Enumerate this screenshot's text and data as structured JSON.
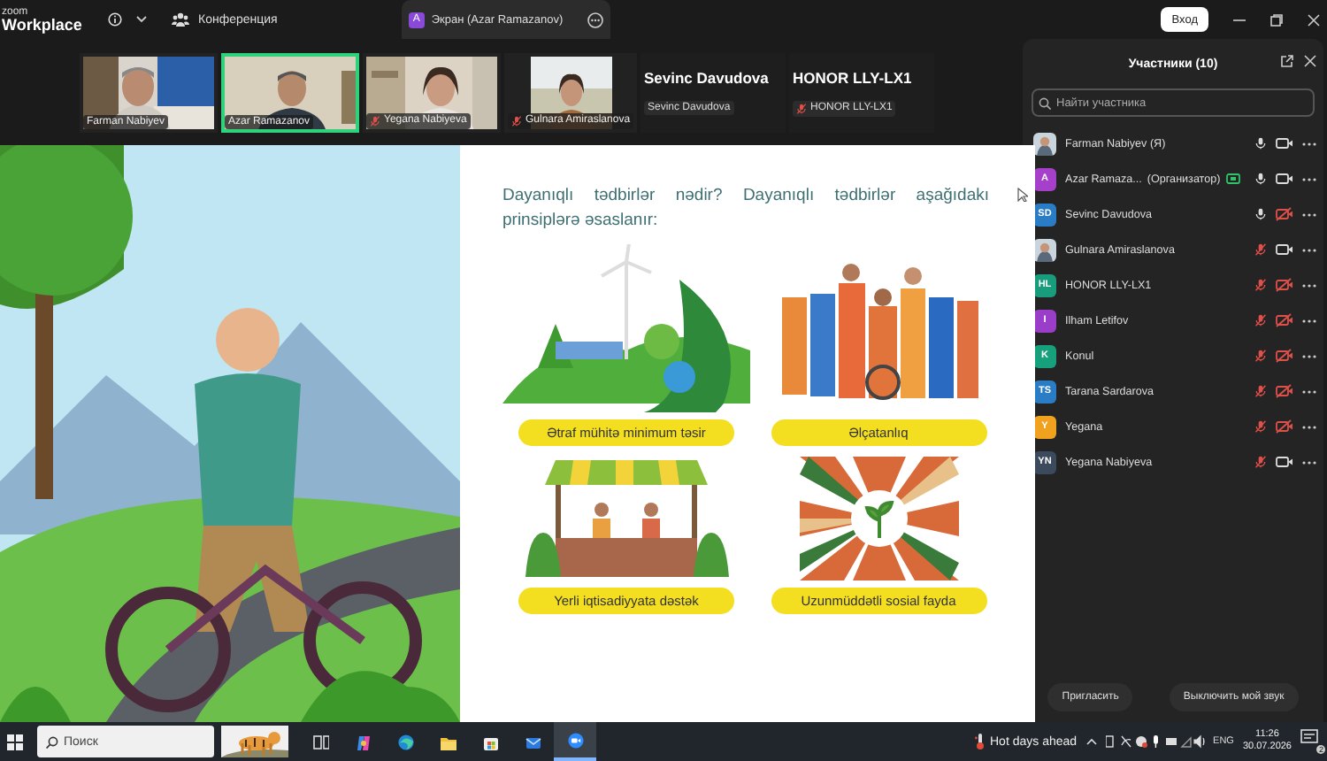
{
  "app": {
    "logo_top": "zoom",
    "logo_bottom": "Workplace"
  },
  "toolbar": {
    "meeting_label": "Конференция",
    "share_tab": {
      "initial": "A",
      "title": "Экран (Azar Ramazanov)"
    },
    "login_button": "Вход"
  },
  "videos": [
    {
      "kind": "video",
      "name": "Farman Nabiyev",
      "muted": false,
      "speaking": false
    },
    {
      "kind": "video",
      "name": "Azar Ramazanov",
      "muted": false,
      "speaking": true
    },
    {
      "kind": "video",
      "name": "Yegana Nabiyeva",
      "muted": true,
      "speaking": false
    },
    {
      "kind": "video",
      "name": "Gulnara Amiraslanova",
      "muted": true,
      "speaking": false
    },
    {
      "kind": "name",
      "title": "Sevinc Davudova",
      "name": "Sevinc Davudova",
      "muted": false,
      "speaking": false
    },
    {
      "kind": "name",
      "title": "HONOR LLY-LX1",
      "name": "HONOR LLY-LX1",
      "muted": true,
      "speaking": false
    }
  ],
  "slide": {
    "intro": "Dayanıqlı tədbirlər nədir? Dayanıqlı tədbirlər aşağıdakı prinsiplərə əsaslanır:",
    "cards": [
      {
        "label": "Ətraf mühitə minimum təsir"
      },
      {
        "label": "Əlçatanlıq"
      },
      {
        "label": "Yerli iqtisadiyyata dəstək"
      },
      {
        "label": "Uzunmüddətli sosial fayda"
      }
    ]
  },
  "participants": {
    "title": "Участники (10)",
    "search_placeholder": "Найти участника",
    "people": [
      {
        "name": "Farman Nabiyev (Я)",
        "muted": false,
        "video_off": false
      },
      {
        "name": "Azar Ramaza...",
        "role": "(Организатор)",
        "kind": "initials",
        "initials": "A",
        "color": "#a63fc9",
        "sharing": true,
        "muted": false,
        "video_off": false
      },
      {
        "name": "Sevinc Davudova",
        "kind": "initials",
        "initials": "SD",
        "color": "#2a7dc4",
        "muted": false,
        "video_off": true
      },
      {
        "name": "Gulnara Amiraslanova",
        "muted": true,
        "video_off": false
      },
      {
        "name": "HONOR LLY-LX1",
        "kind": "initials",
        "initials": "HL",
        "color": "#189c7c",
        "muted": true,
        "video_off": true
      },
      {
        "name": "Ilham Letifov",
        "kind": "initials",
        "initials": "I",
        "color": "#9a3ec9",
        "muted": true,
        "video_off": true
      },
      {
        "name": "Konul",
        "kind": "initials",
        "initials": "K",
        "color": "#17a07c",
        "muted": true,
        "video_off": true
      },
      {
        "name": "Tarana Sardarova",
        "kind": "initials",
        "initials": "TS",
        "color": "#2a7dc4",
        "muted": true,
        "video_off": true
      },
      {
        "name": "Yegana",
        "kind": "initials",
        "initials": "Y",
        "color": "#f0a21e",
        "muted": true,
        "video_off": true
      },
      {
        "name": "Yegana Nabiyeva",
        "kind": "initials",
        "initials": "YN",
        "color": "#3b4a5c",
        "muted": true,
        "video_off": false
      }
    ],
    "buttons": [
      "Пригласить",
      "Выключить мой звук"
    ]
  },
  "taskbar": {
    "search_placeholder": "Поиск",
    "apps": [
      {
        "kind": "taskview",
        "active": false
      },
      {
        "kind": "copilot",
        "active": false
      },
      {
        "kind": "browser",
        "active": false
      },
      {
        "kind": "folder",
        "active": false
      },
      {
        "kind": "store",
        "active": false
      },
      {
        "kind": "mail",
        "active": false
      },
      {
        "kind": "zoom",
        "active": true
      }
    ],
    "weather": "Hot days ahead",
    "language": "ENG",
    "time": "11:26",
    "date": "30.07.2026",
    "notifications": "2"
  }
}
